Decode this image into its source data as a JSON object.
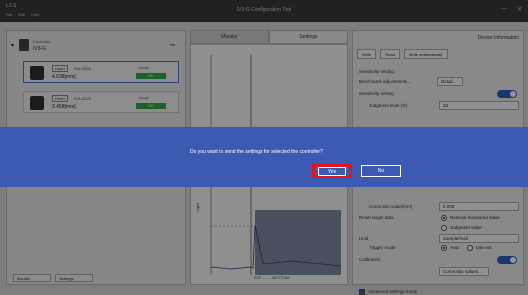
{
  "app": {
    "logo": "LJ-S",
    "title": "IV3-G Configuration Tool",
    "menu": [
      "File",
      "Edit",
      "Help"
    ],
    "win_controls": [
      "—",
      "✕"
    ]
  },
  "tree": {
    "root_label": "Controller",
    "root_value": "IV3-G",
    "nodes": [
      {
        "tag": "Head",
        "name": "IV3-G500",
        "value": "4.638[mm]",
        "status_label": "Judge",
        "status": "OK"
      },
      {
        "tag": "Head",
        "name": "IV3-G120",
        "value": "2.458[mm]",
        "status_label": "Judge",
        "status": "OK"
      }
    ],
    "bottom_buttons": [
      "Monitor",
      "Settings"
    ]
  },
  "tabs": [
    "Monitor",
    "Settings"
  ],
  "chart": {
    "xlabel": "TOP ← → BOTTOM",
    "ylabel": "Light"
  },
  "settings": {
    "device_info": "Device information",
    "toolbar": [
      "Write",
      "Read",
      "Write automatically"
    ],
    "section": "Sensitivity setting",
    "bench_label": "Benchmark adjustments...",
    "bench_btn": "Detail...",
    "sens_label": "Sensitivity setting",
    "judgment_label": "Judgment level (%)",
    "judgment_value": "25",
    "correction_label": "Correction value(mm)",
    "correction_value": "0.000",
    "reset_label": "Reset target data",
    "reset_opt1": "Nominal measured value",
    "reset_opt2": "Judgment value",
    "hold_label": "Hold",
    "hold_value": "Sample/hold",
    "trigger_label": "Trigger mode",
    "trigger_opt1": "Auto",
    "trigger_opt2": "Use ext.",
    "calib_label": "Calibration",
    "calib_btn": "Correction values...",
    "advanced_label": "Advanced settings mode"
  },
  "dialog": {
    "message": "Do you want to send the settings for selected the controller?",
    "yes": "Yes",
    "no": "No"
  }
}
